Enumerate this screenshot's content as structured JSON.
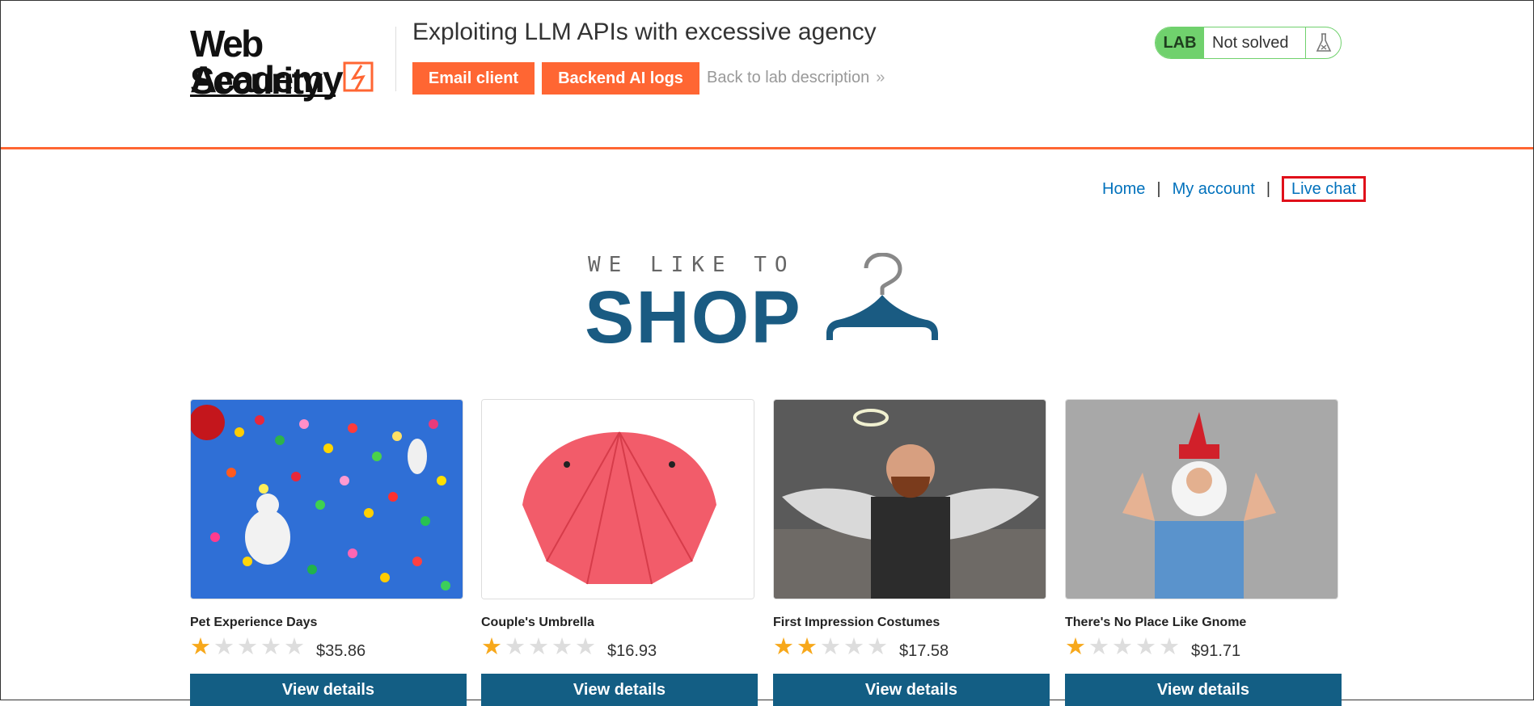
{
  "header": {
    "logo_line1": "Web Security",
    "logo_line2": "Academy",
    "lab_title": "Exploiting LLM APIs with excessive agency",
    "email_client_label": "Email client",
    "backend_logs_label": "Backend AI logs",
    "back_link_label": "Back to lab description",
    "status_badge": "LAB",
    "status_text": "Not solved"
  },
  "nav": {
    "home": "Home",
    "separator": "|",
    "my_account": "My account",
    "live_chat": "Live chat"
  },
  "hero": {
    "tagline": "WE LIKE TO",
    "title": "SHOP"
  },
  "products": [
    {
      "name": "Pet Experience Days",
      "rating": 1,
      "max_rating": 5,
      "price": "$35.86",
      "button": "View details"
    },
    {
      "name": "Couple's Umbrella",
      "rating": 1,
      "max_rating": 5,
      "price": "$16.93",
      "button": "View details"
    },
    {
      "name": "First Impression Costumes",
      "rating": 2,
      "max_rating": 5,
      "price": "$17.58",
      "button": "View details"
    },
    {
      "name": "There's No Place Like Gnome",
      "rating": 1,
      "max_rating": 5,
      "price": "$91.71",
      "button": "View details"
    }
  ],
  "colors": {
    "accent_orange": "#ff6633",
    "brand_blue": "#135e84",
    "link_blue": "#0071bc",
    "status_green": "#70d16d",
    "star_filled": "#f7a81b",
    "highlight_red": "#e0101a"
  }
}
